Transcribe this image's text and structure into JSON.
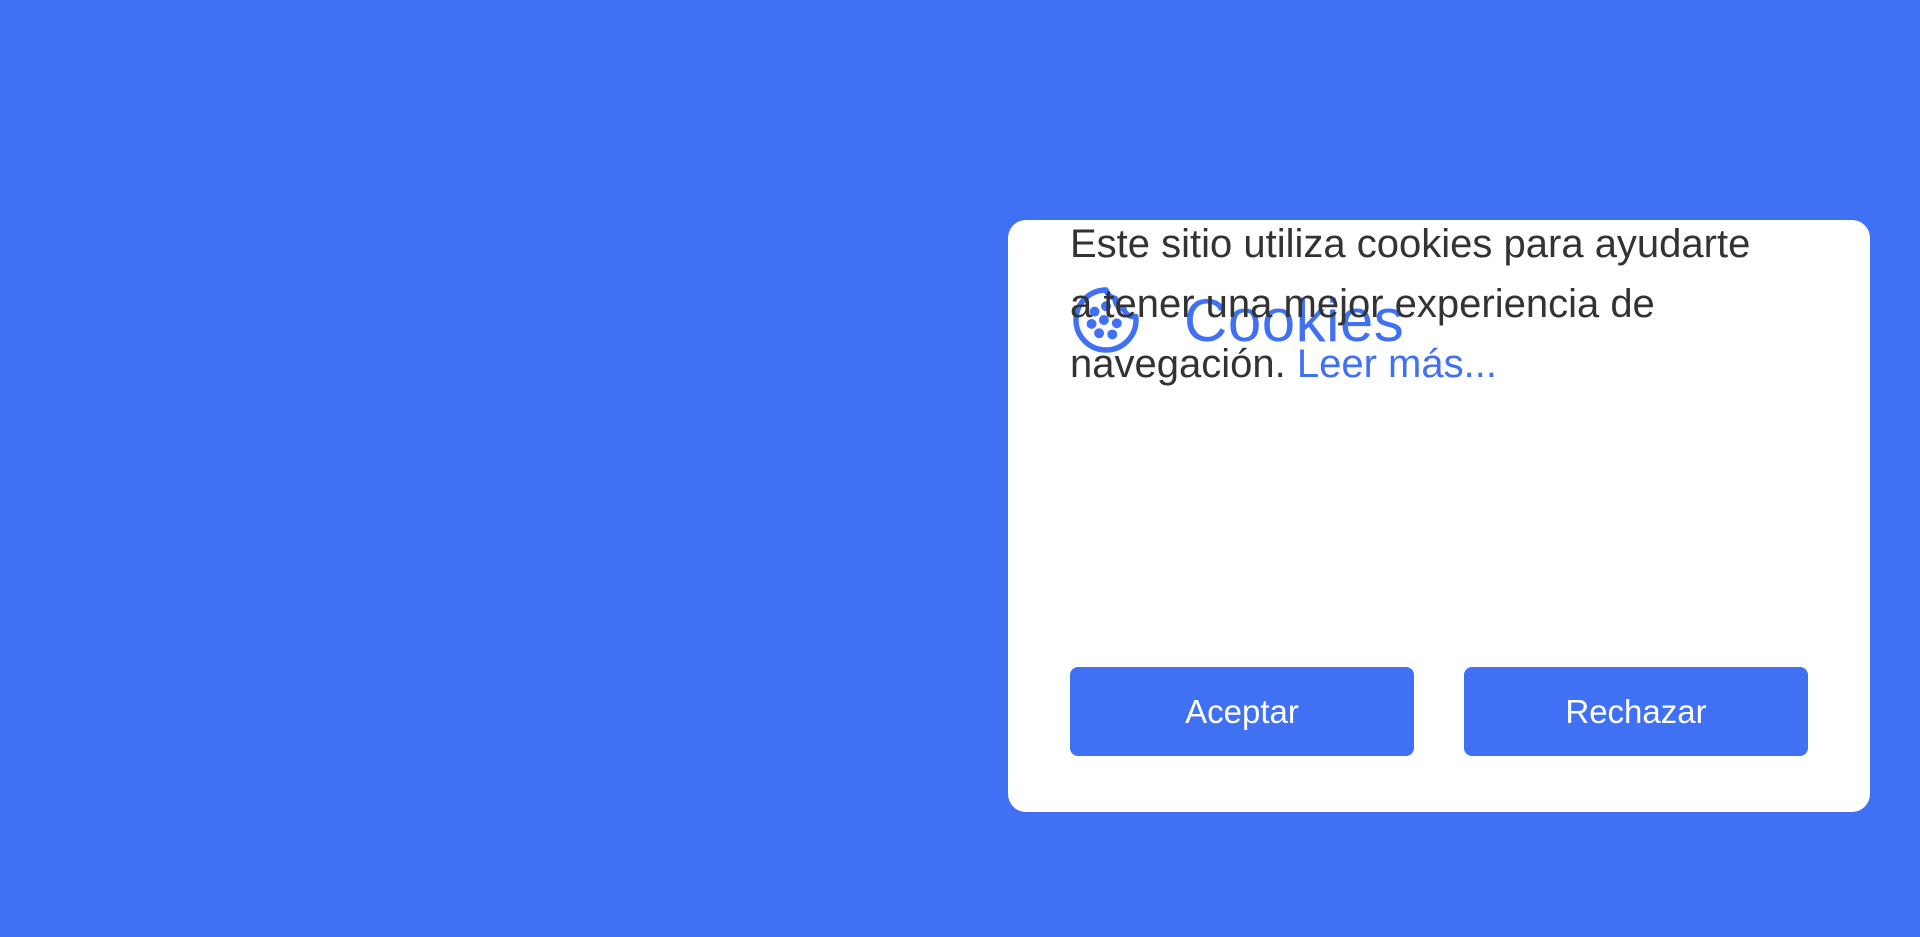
{
  "colors": {
    "background": "#4070f4",
    "card": "#ffffff",
    "accent": "#4070f4",
    "text": "#333333",
    "button_text": "#ffffff"
  },
  "cookie_card": {
    "icon": "cookie-icon",
    "title": "Cookies",
    "message": "Este sitio utiliza cookies para ayudarte a tener una mejor experiencia de navegación.",
    "read_more_label": "Leer más...",
    "accept_label": "Aceptar",
    "reject_label": "Rechazar"
  }
}
